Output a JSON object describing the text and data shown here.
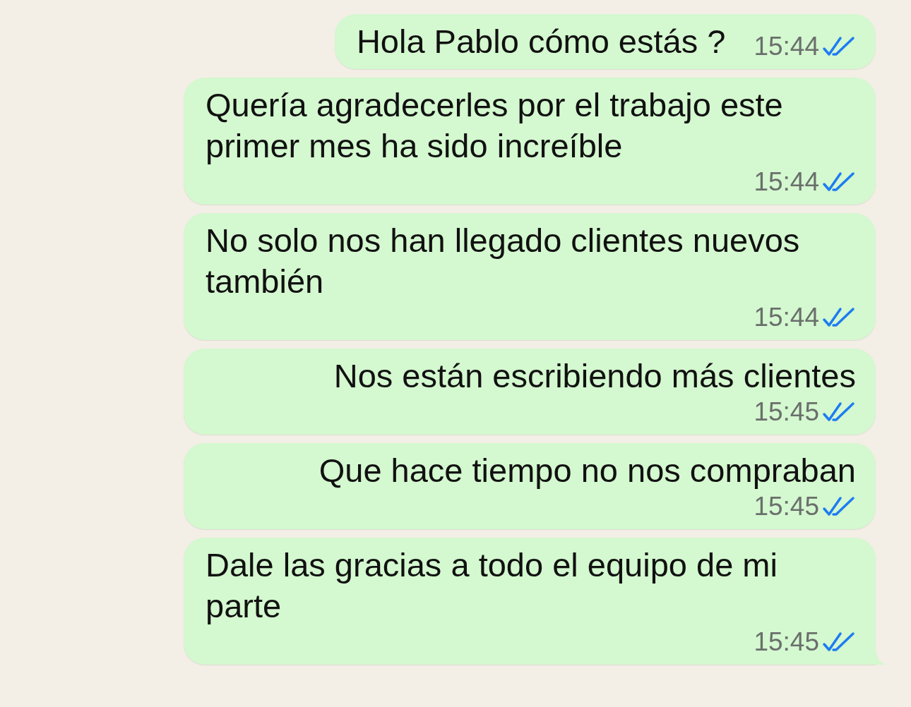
{
  "messages": [
    {
      "text": "Hola Pablo cómo estás ?",
      "time": "15:44",
      "read": true,
      "tail": false
    },
    {
      "text": "Quería agradecerles por el trabajo este primer mes ha sido increíble",
      "time": "15:44",
      "read": true,
      "tail": false
    },
    {
      "text": "No solo nos han llegado clientes nuevos también",
      "time": "15:44",
      "read": true,
      "tail": false
    },
    {
      "text": "Nos están escribiendo más clientes",
      "time": "15:45",
      "read": true,
      "tail": false
    },
    {
      "text": "Que hace tiempo no nos compraban",
      "time": "15:45",
      "read": true,
      "tail": false
    },
    {
      "text": "Dale las gracias a todo el equipo de mi parte",
      "time": "15:45",
      "read": true,
      "tail": true
    }
  ]
}
